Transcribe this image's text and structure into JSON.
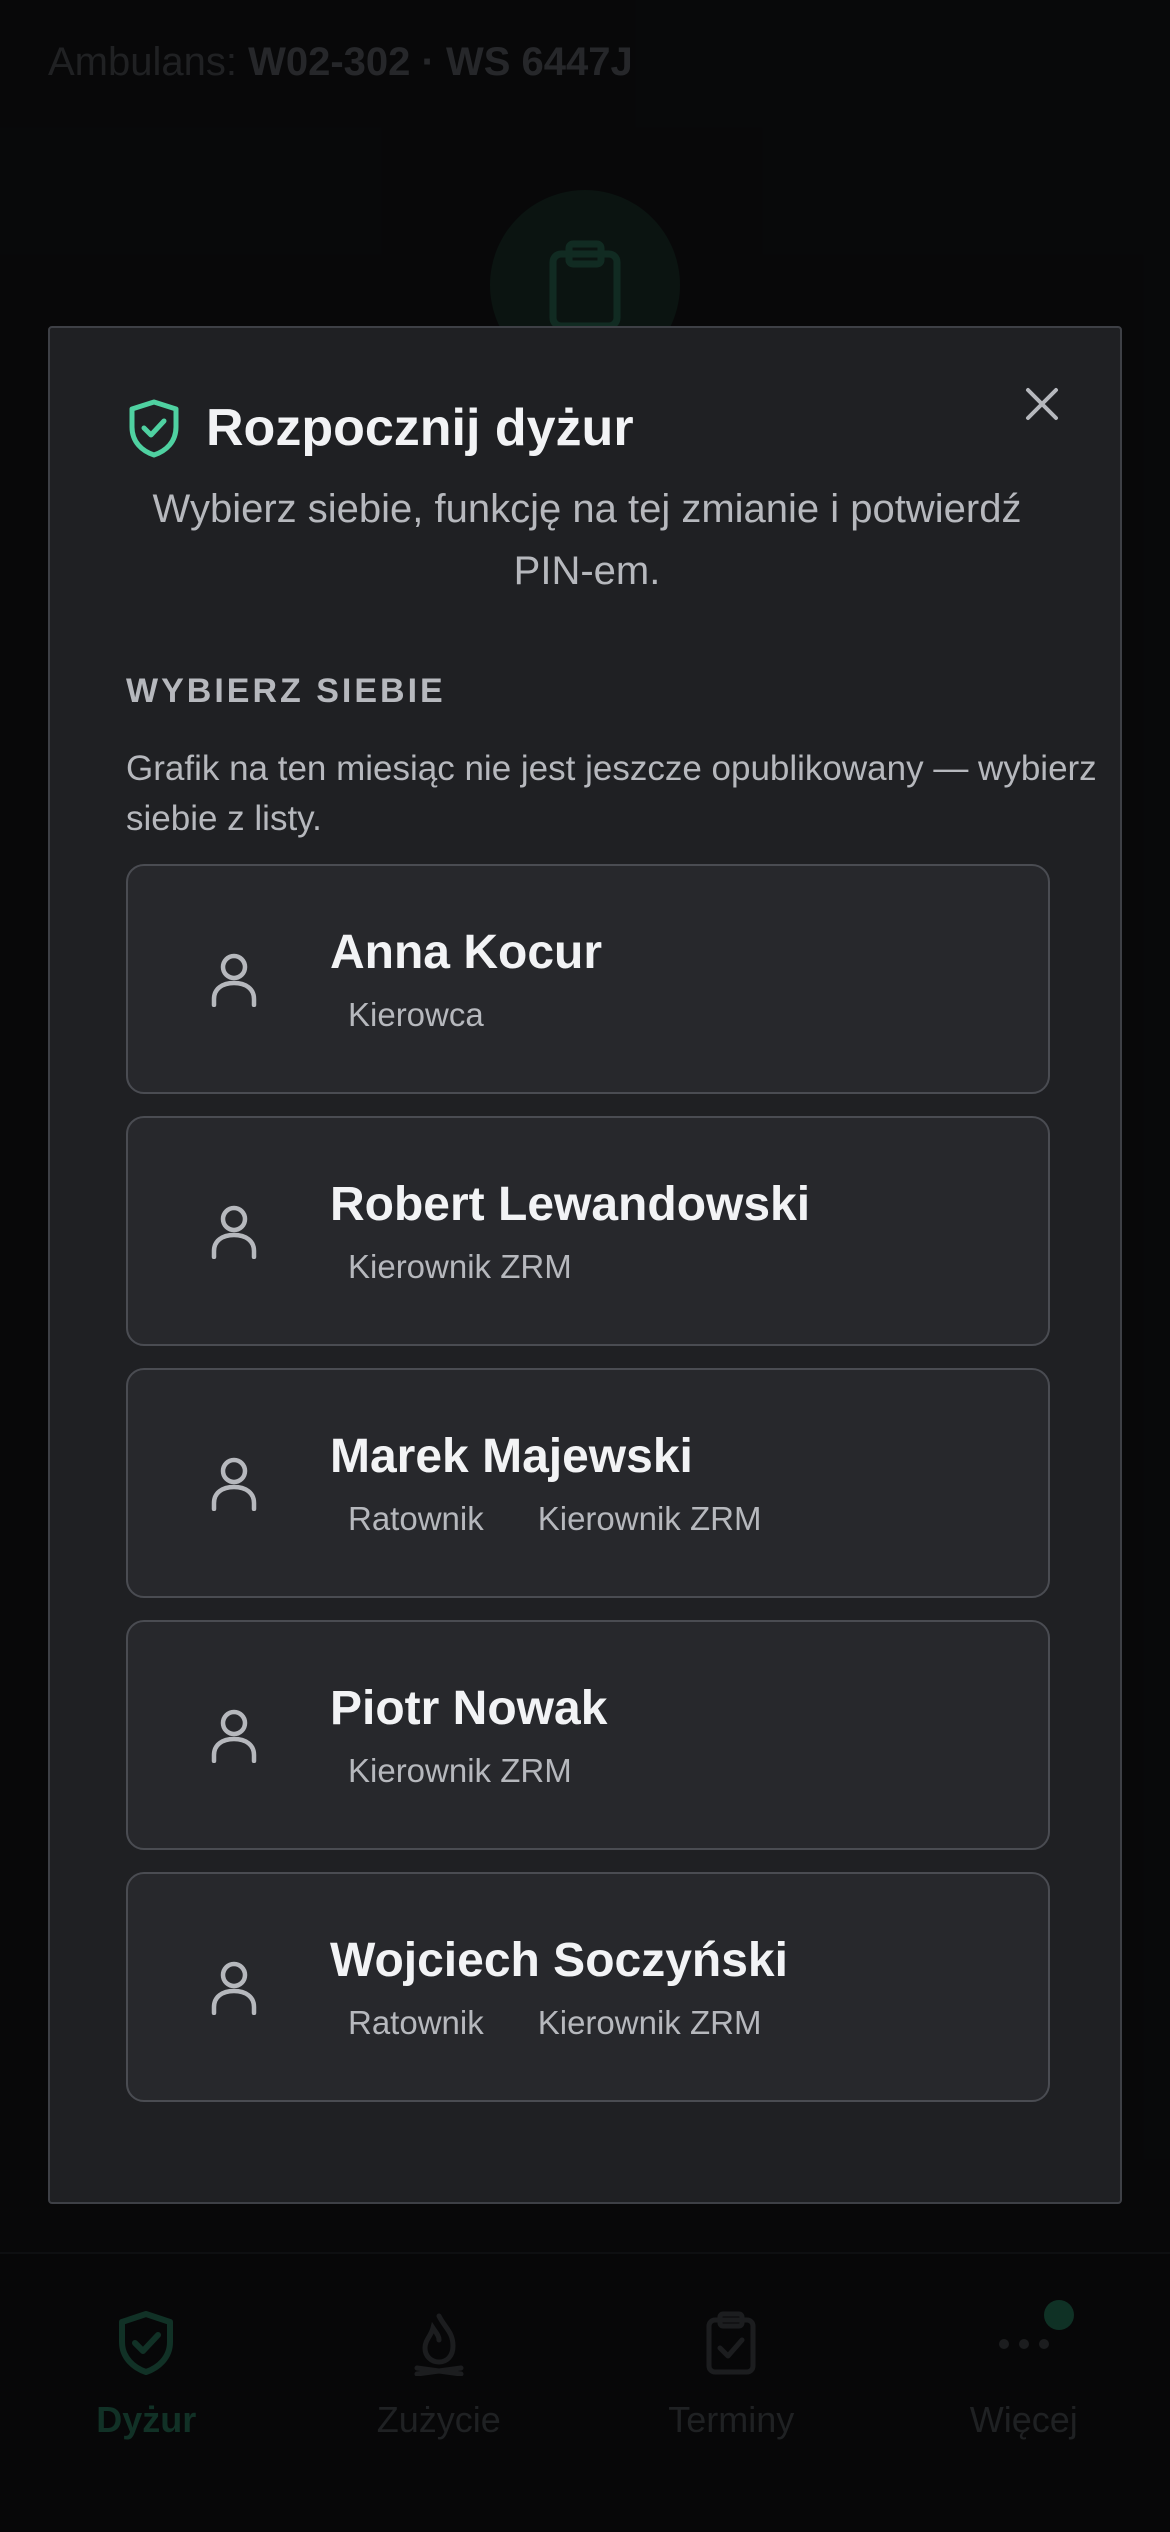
{
  "background": {
    "ambulance_prefix": "Ambulans:",
    "ambulance_id": "W02-302 · WS 6447J"
  },
  "modal": {
    "title": "Rozpocznij dyżur",
    "subtitle": "Wybierz siebie, funkcję na tej zmianie i potwierdź PIN-em.",
    "section_title": "WYBIERZ SIEBIE",
    "section_note": "Grafik na ten miesiąc nie jest jeszcze opublikowany — wybierz siebie z listy.",
    "people": [
      {
        "name": "Anna Kocur",
        "roles": [
          "Kierowca"
        ]
      },
      {
        "name": "Robert Lewandowski",
        "roles": [
          "Kierownik ZRM"
        ]
      },
      {
        "name": "Marek Majewski",
        "roles": [
          "Ratownik",
          "Kierownik ZRM"
        ]
      },
      {
        "name": "Piotr Nowak",
        "roles": [
          "Kierownik ZRM"
        ]
      },
      {
        "name": "Wojciech Soczyński",
        "roles": [
          "Ratownik",
          "Kierownik ZRM"
        ]
      }
    ]
  },
  "tabbar": {
    "tabs": [
      {
        "label": "Dyżur",
        "icon": "shield-check-icon",
        "active": true
      },
      {
        "label": "Zużycie",
        "icon": "flame-icon",
        "active": false
      },
      {
        "label": "Terminy",
        "icon": "clipboard-check-icon",
        "active": false
      },
      {
        "label": "Więcej",
        "icon": "more-dots-icon",
        "active": false
      }
    ]
  },
  "colors": {
    "accent": "#4fd1a1",
    "modal_bg": "#1f2023",
    "card_bg": "#27282c",
    "text_primary": "#f2f3f5",
    "text_secondary": "#b6b8bd"
  }
}
